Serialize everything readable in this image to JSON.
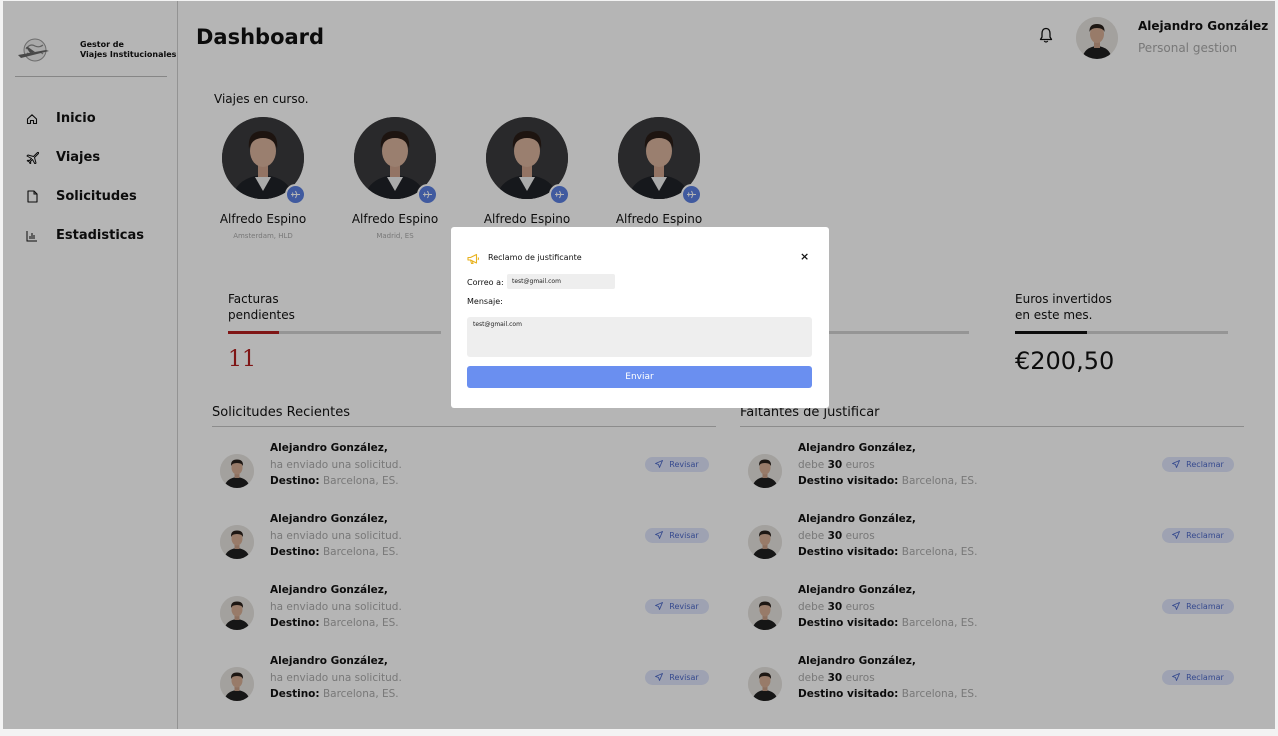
{
  "brand": {
    "line1": "Gestor de",
    "line2": "Viajes Institucionales"
  },
  "nav": [
    {
      "label": "Inicio",
      "icon": "home-icon"
    },
    {
      "label": "Viajes",
      "icon": "plane-icon"
    },
    {
      "label": "Solicitudes",
      "icon": "file-icon"
    },
    {
      "label": "Estadisticas",
      "icon": "bar-chart-icon"
    }
  ],
  "header": {
    "title": "Dashboard",
    "user_name": "Alejandro González",
    "user_role": "Personal gestion"
  },
  "trips": {
    "label": "Viajes en curso.",
    "items": [
      {
        "name": "Alfredo Espino",
        "location": "Amsterdam, HLD"
      },
      {
        "name": "Alfredo Espino",
        "location": "Madrid, ES"
      },
      {
        "name": "Alfredo Espino",
        "location": ""
      },
      {
        "name": "Alfredo Espino",
        "location": ""
      }
    ]
  },
  "stats": {
    "pending_label_1": "Facturas",
    "pending_label_2": "pendientes",
    "pending_value": "11",
    "pending_progress": 0.24,
    "euros_label_1": "Euros invertidos",
    "euros_label_2": "en este mes.",
    "euros_value": "€200,50",
    "euros_progress": 0.34,
    "middle_progress": 0
  },
  "requests": {
    "title": "Solicitudes Recientes",
    "button": "Revisar",
    "items": [
      {
        "name": "Alejandro González,",
        "line2": "ha enviado una solicitud.",
        "dest_label": "Destino:",
        "dest": "Barcelona, ES."
      },
      {
        "name": "Alejandro González,",
        "line2": "ha enviado una solicitud.",
        "dest_label": "Destino:",
        "dest": "Barcelona, ES."
      },
      {
        "name": "Alejandro González,",
        "line2": "ha enviado una solicitud.",
        "dest_label": "Destino:",
        "dest": "Barcelona, ES."
      },
      {
        "name": "Alejandro González,",
        "line2": "ha enviado una solicitud.",
        "dest_label": "Destino:",
        "dest": "Barcelona, ES."
      }
    ]
  },
  "missing": {
    "title": "Faltantes de justificar",
    "button": "Reclamar",
    "items": [
      {
        "name": "Alejandro González,",
        "owe_pre": "debe",
        "amount": "30",
        "owe_post": "euros",
        "dest_label": "Destino visitado:",
        "dest": "Barcelona, ES."
      },
      {
        "name": "Alejandro González,",
        "owe_pre": "debe",
        "amount": "30",
        "owe_post": "euros",
        "dest_label": "Destino visitado:",
        "dest": "Barcelona, ES."
      },
      {
        "name": "Alejandro González,",
        "owe_pre": "debe",
        "amount": "30",
        "owe_post": "euros",
        "dest_label": "Destino visitado:",
        "dest": "Barcelona, ES."
      },
      {
        "name": "Alejandro González,",
        "owe_pre": "debe",
        "amount": "30",
        "owe_post": "euros",
        "dest_label": "Destino visitado:",
        "dest": "Barcelona, ES."
      }
    ]
  },
  "modal": {
    "title": "Reclamo de justificante",
    "to_label": "Correo a:",
    "email": "test@gmail.com",
    "message_label": "Mensaje:",
    "message": "test@gmail.com",
    "send": "Enviar",
    "close": "×"
  },
  "colors": {
    "accent": "#6a8ff0",
    "danger": "#b41e1e",
    "badge": "#5b7fe0",
    "warning": "#e8b21e"
  }
}
